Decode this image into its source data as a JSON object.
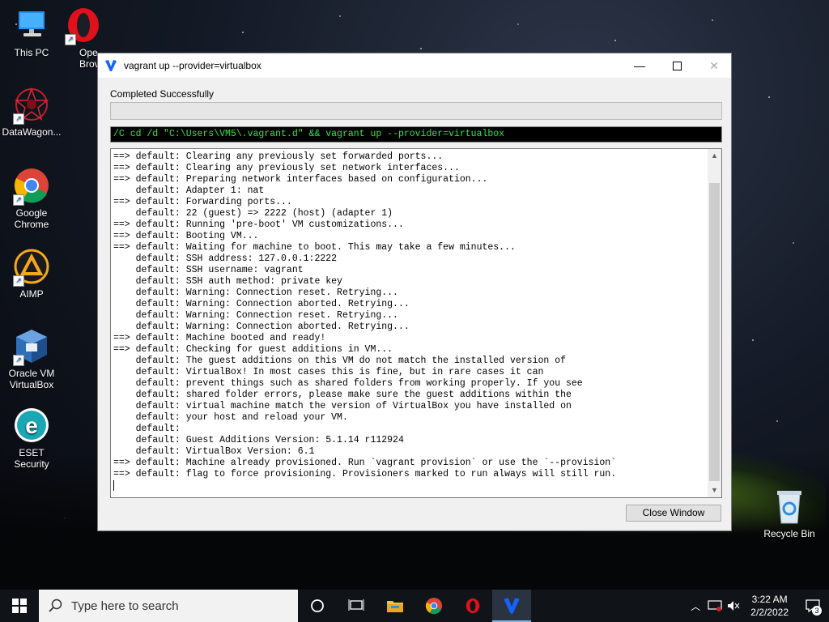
{
  "desktop": {
    "icons": [
      {
        "label": "This PC"
      },
      {
        "label": "Opera Browser",
        "visible_label": "Ope\nBrov"
      },
      {
        "label": "DataWagon..."
      },
      {
        "label": "Google Chrome"
      },
      {
        "label": "AIMP"
      },
      {
        "label": "Oracle VM VirtualBox"
      },
      {
        "label": "ESET Security"
      },
      {
        "label": "Recycle Bin"
      }
    ]
  },
  "window": {
    "title": "vagrant up --provider=virtualbox",
    "status": "Completed Successfully",
    "command": "/C cd /d \"C:\\Users\\VM5\\.vagrant.d\" && vagrant up --provider=virtualbox",
    "console_lines": [
      "==> default: Clearing any previously set forwarded ports...",
      "==> default: Clearing any previously set network interfaces...",
      "==> default: Preparing network interfaces based on configuration...",
      "    default: Adapter 1: nat",
      "==> default: Forwarding ports...",
      "    default: 22 (guest) => 2222 (host) (adapter 1)",
      "==> default: Running 'pre-boot' VM customizations...",
      "==> default: Booting VM...",
      "==> default: Waiting for machine to boot. This may take a few minutes...",
      "    default: SSH address: 127.0.0.1:2222",
      "    default: SSH username: vagrant",
      "    default: SSH auth method: private key",
      "    default: Warning: Connection reset. Retrying...",
      "    default: Warning: Connection aborted. Retrying...",
      "    default: Warning: Connection reset. Retrying...",
      "    default: Warning: Connection aborted. Retrying...",
      "==> default: Machine booted and ready!",
      "==> default: Checking for guest additions in VM...",
      "    default: The guest additions on this VM do not match the installed version of",
      "    default: VirtualBox! In most cases this is fine, but in rare cases it can",
      "    default: prevent things such as shared folders from working properly. If you see",
      "    default: shared folder errors, please make sure the guest additions within the",
      "    default: virtual machine match the version of VirtualBox you have installed on",
      "    default: your host and reload your VM.",
      "    default:",
      "    default: Guest Additions Version: 5.1.14 r112924",
      "    default: VirtualBox Version: 6.1",
      "==> default: Machine already provisioned. Run `vagrant provision` or use the `--provision`",
      "==> default: flag to force provisioning. Provisioners marked to run always will still run."
    ],
    "close_button": "Close Window"
  },
  "taskbar": {
    "search_placeholder": "Type here to search",
    "time": "3:22 AM",
    "date": "2/2/2022",
    "notification_count": "3"
  },
  "colors": {
    "console_green": "#2ee64b",
    "vagrant_blue": "#1563ff",
    "opera_red": "#e0111b"
  }
}
